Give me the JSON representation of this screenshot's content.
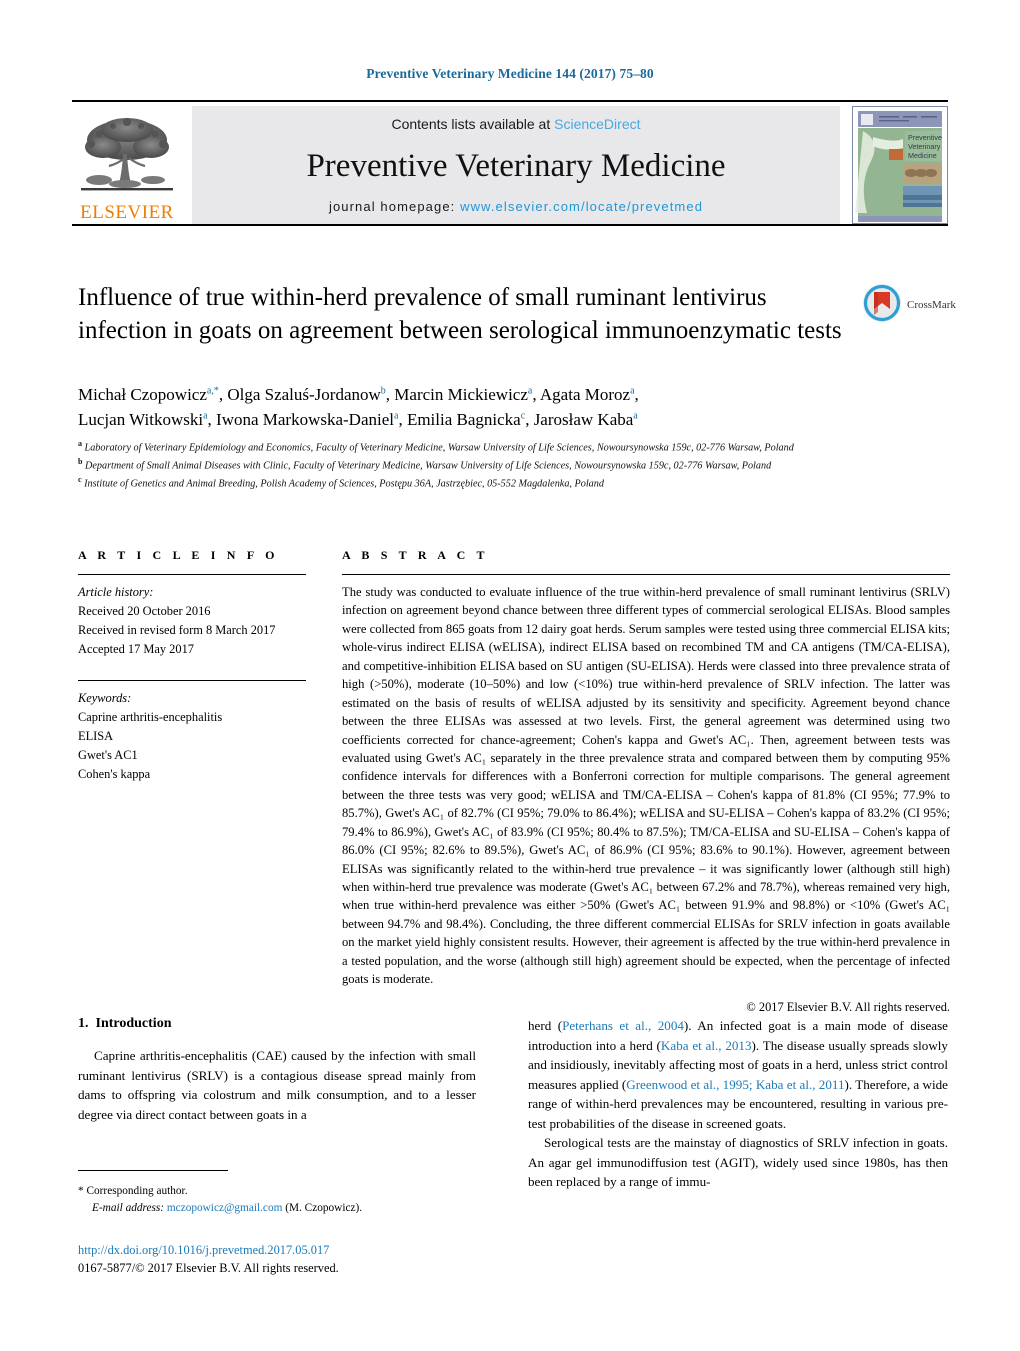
{
  "running_head": "Preventive Veterinary Medicine 144 (2017) 75–80",
  "masthead": {
    "publisher_logo_name": "elsevier-tree-logo",
    "publisher_wordmark": "ELSEVIER",
    "contents_prefix": "Contents lists available at ",
    "contents_link": "ScienceDirect",
    "journal_title": "Preventive Veterinary Medicine",
    "homepage_prefix": "journal homepage: ",
    "homepage_url": "www.elsevier.com/locate/prevetmed",
    "cover_title_lines": [
      "Preventive",
      "Veterinary",
      "Medicine"
    ]
  },
  "article": {
    "title": "Influence of true within-herd prevalence of small ruminant lentivirus infection in goats on agreement between serological immunoenzymatic tests",
    "crossmark_label": "CrossMark",
    "authors_line1": "Michał Czopowicza,*, Olga Szaluś-Jordanowb, Marcin Mickiewicza, Agata Moroza,",
    "authors_line2": "Lucjan Witkowskia, Iwona Markowska-Daniela, Emilia Bagnickac, Jarosław Kabaa",
    "authors": [
      {
        "name": "Michał Czopowicz",
        "sup": "a,*"
      },
      {
        "name": "Olga Szaluś-Jordanow",
        "sup": "b"
      },
      {
        "name": "Marcin Mickiewicz",
        "sup": "a"
      },
      {
        "name": "Agata Moroz",
        "sup": "a"
      },
      {
        "name": "Lucjan Witkowski",
        "sup": "a"
      },
      {
        "name": "Iwona Markowska-Daniel",
        "sup": "a"
      },
      {
        "name": "Emilia Bagnicka",
        "sup": "c"
      },
      {
        "name": "Jarosław Kaba",
        "sup": "a"
      }
    ],
    "affiliations": [
      {
        "sup": "a",
        "text": "Laboratory of Veterinary Epidemiology and Economics, Faculty of Veterinary Medicine, Warsaw University of Life Sciences, Nowoursynowska 159c, 02-776 Warsaw, Poland"
      },
      {
        "sup": "b",
        "text": "Department of Small Animal Diseases with Clinic, Faculty of Veterinary Medicine, Warsaw University of Life Sciences, Nowoursynowska 159c, 02-776 Warsaw, Poland"
      },
      {
        "sup": "c",
        "text": "Institute of Genetics and Animal Breeding, Polish Academy of Sciences, Postępu 36A, Jastrzębiec, 05-552 Magdalenka, Poland"
      }
    ]
  },
  "article_info": {
    "heading": "A R T I C L E   I N F O",
    "history_label": "Article history:",
    "history": [
      "Received 20 October 2016",
      "Received in revised form 8 March 2017",
      "Accepted 17 May 2017"
    ],
    "keywords_label": "Keywords:",
    "keywords": [
      "Caprine arthritis-encephalitis",
      "ELISA",
      "Gwet's AC1",
      "Cohen's kappa"
    ]
  },
  "abstract": {
    "heading": "A B S T R A C T",
    "text": "The study was conducted to evaluate influence of the true within-herd prevalence of small ruminant lentivirus (SRLV) infection on agreement beyond chance between three different types of commercial serological ELISAs. Blood samples were collected from 865 goats from 12 dairy goat herds. Serum samples were tested using three commercial ELISA kits; whole-virus indirect ELISA (wELISA), indirect ELISA based on recombined TM and CA antigens (TM/CA-ELISA), and competitive-inhibition ELISA based on SU antigen (SU-ELISA). Herds were classed into three prevalence strata of high (>50%), moderate (10–50%) and low (<10%) true within-herd prevalence of SRLV infection. The latter was estimated on the basis of results of wELISA adjusted by its sensitivity and specificity. Agreement beyond chance between the three ELISAs was assessed at two levels. First, the general agreement was determined using two coefficients corrected for chance-agreement; Cohen's kappa and Gwet's AC₁. Then, agreement between tests was evaluated using Gwet's AC₁ separately in the three prevalence strata and compared between them by computing 95% confidence intervals for differences with a Bonferroni correction for multiple comparisons. The general agreement between the three tests was very good; wELISA and TM/CA-ELISA – Cohen's kappa of 81.8% (CI 95%; 77.9% to 85.7%), Gwet's AC₁ of 82.7% (CI 95%; 79.0% to 86.4%); wELISA and SU-ELISA – Cohen's kappa of 83.2% (CI 95%; 79.4% to 86.9%), Gwet's AC₁ of 83.9% (CI 95%; 80.4% to 87.5%); TM/CA-ELISA and SU-ELISA – Cohen's kappa of 86.0% (CI 95%; 82.6% to 89.5%), Gwet's AC₁ of 86.9% (CI 95%; 83.6% to 90.1%). However, agreement between ELISAs was significantly related to the within-herd true prevalence – it was significantly lower (although still high) when within-herd true prevalence was moderate (Gwet's AC₁ between 67.2% and 78.7%), whereas remained very high, when true within-herd prevalence was either >50% (Gwet's AC₁ between 91.9% and 98.8%) or <10% (Gwet's AC₁ between 94.7% and 98.4%). Concluding, the three different commercial ELISAs for SRLV infection in goats available on the market yield highly consistent results. However, their agreement is affected by the true within-herd prevalence in a tested population, and the worse (although still high) agreement should be expected, when the percentage of infected goats is moderate.",
    "copyright": "© 2017 Elsevier B.V. All rights reserved."
  },
  "body": {
    "section_number": "1.",
    "section_title": "Introduction",
    "left_paragraph": "Caprine arthritis-encephalitis (CAE) caused by the infection with small ruminant lentivirus (SRLV) is a contagious disease spread mainly from dams to offspring via colostrum and milk consumption, and to a lesser degree via direct contact between goats in a",
    "right_paragraph_1_pre": "herd (",
    "right_paragraph_1_ref1": "Peterhans et al., 2004",
    "right_paragraph_1_mid1": "). An infected goat is a main mode of disease introduction into a herd (",
    "right_paragraph_1_ref2": "Kaba et al., 2013",
    "right_paragraph_1_mid2": "). The disease usually spreads slowly and insidiously, inevitably affecting most of goats in a herd, unless strict control measures applied (",
    "right_paragraph_1_ref3": "Greenwood et al., 1995; Kaba et al., 2011",
    "right_paragraph_1_post": "). Therefore, a wide range of within-herd prevalences may be encountered, resulting in various pre-test probabilities of the disease in screened goats.",
    "right_paragraph_2": "Serological tests are the mainstay of diagnostics of SRLV infection in goats. An agar gel immunodiffusion test (AGIT), widely used since 1980s, has then been replaced by a range of immu-"
  },
  "footer": {
    "corresponding_marker": "*",
    "corresponding_label": "Corresponding author.",
    "email_label": "E-mail address:",
    "email": "mczopowicz@gmail.com",
    "email_suffix": "(M. Czopowicz).",
    "doi": "http://dx.doi.org/10.1016/j.prevetmed.2017.05.017",
    "issn_line": "0167-5877/© 2017 Elsevier B.V. All rights reserved."
  },
  "colors": {
    "link_blue": "#1a7bb9",
    "header_blue": "#1a6a9b",
    "sciencedirect_blue": "#4aa8dd",
    "elsevier_orange": "#f07d00",
    "banner_gray": "#e8e8ea"
  }
}
